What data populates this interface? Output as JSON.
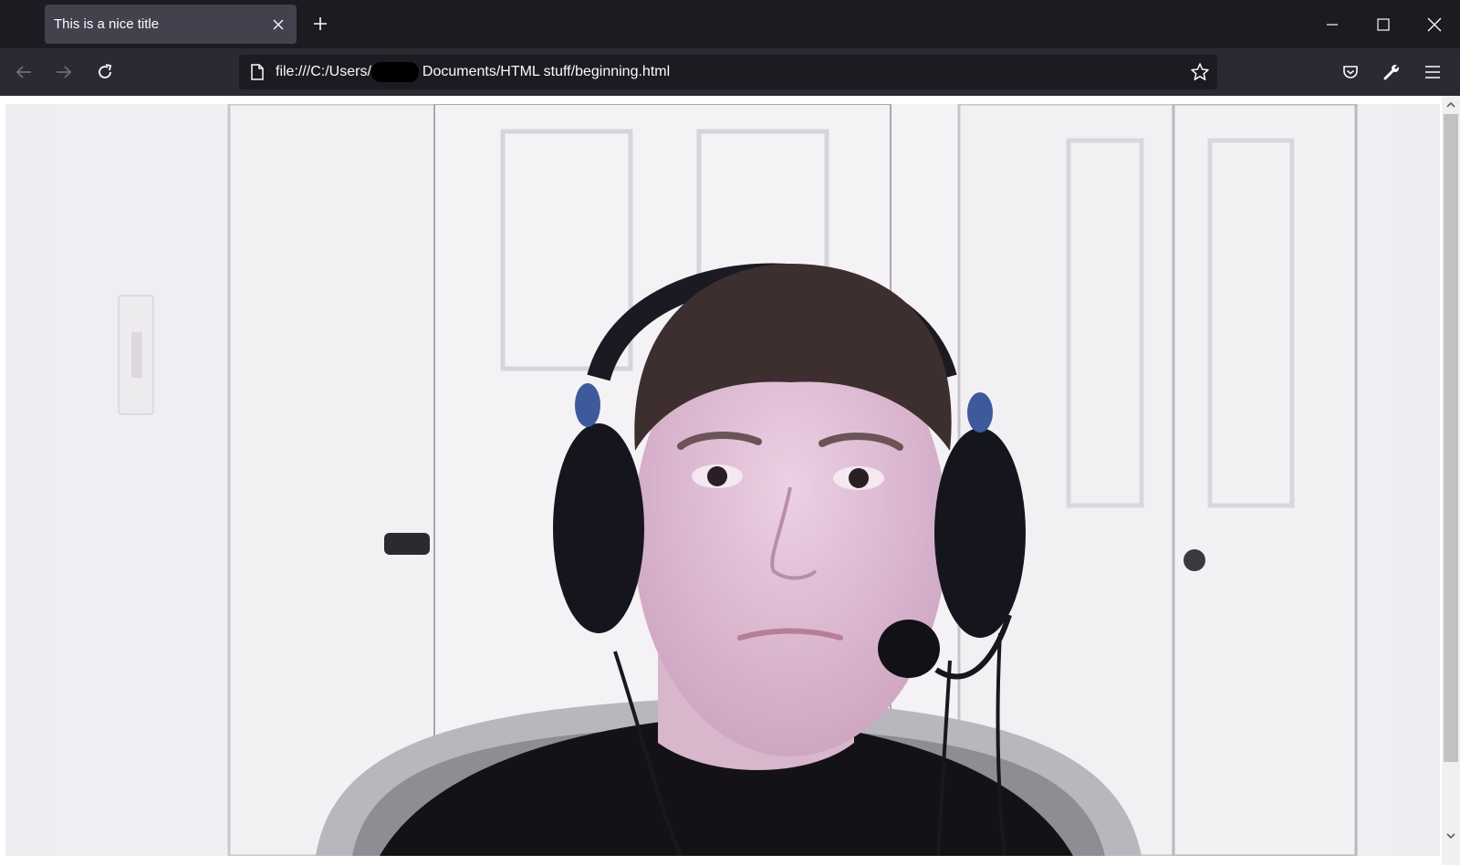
{
  "tab": {
    "title": "This is a nice title"
  },
  "urlbar": {
    "prefix": "file:///C:/Users/",
    "suffix": "Documents/HTML stuff/beginning.html"
  },
  "icons": {
    "close_tab": "close-icon",
    "new_tab": "plus-icon",
    "minimize": "minimize-icon",
    "maximize": "maximize-icon",
    "close_window": "close-window-icon",
    "back": "back-arrow-icon",
    "forward": "forward-arrow-icon",
    "reload": "reload-icon",
    "page": "page-icon",
    "bookmark": "star-icon",
    "pocket": "pocket-icon",
    "tools": "wrench-icon",
    "menu": "hamburger-menu-icon"
  },
  "colors": {
    "tabbar": "#1c1b22",
    "navbar": "#2b2a33",
    "active_tab": "#42414d",
    "text": "#fbfbfe"
  }
}
